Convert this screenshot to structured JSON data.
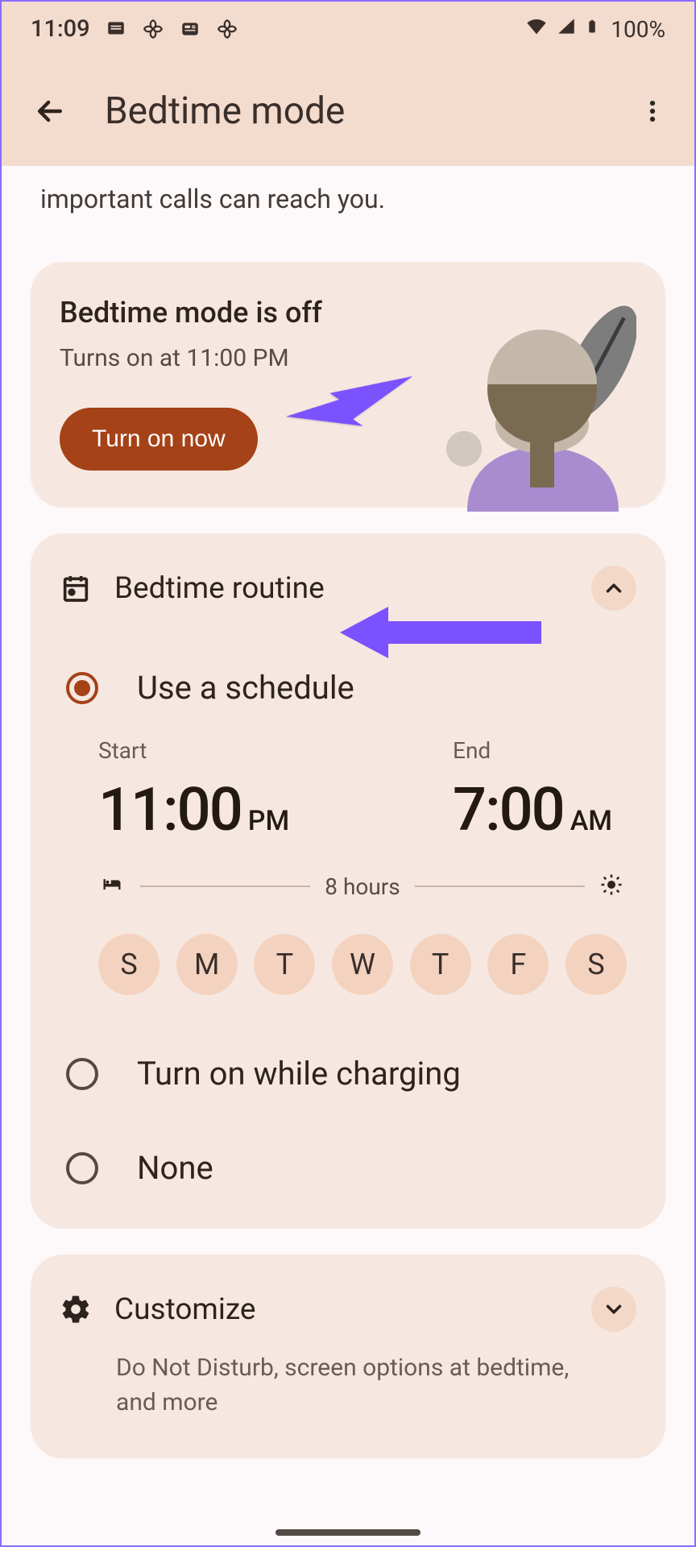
{
  "status_bar": {
    "time": "11:09",
    "battery_text": "100%"
  },
  "app_bar": {
    "title": "Bedtime mode"
  },
  "intro_text": "important calls can reach you.",
  "off_card": {
    "title": "Bedtime mode is off",
    "subtitle": "Turns on at 11:00 PM",
    "button_label": "Turn on now"
  },
  "routine": {
    "title": "Bedtime routine",
    "option_schedule": "Use a schedule",
    "option_charging": "Turn on while charging",
    "option_none": "None",
    "start_label": "Start",
    "end_label": "End",
    "start_time": "11:00",
    "start_ampm": "PM",
    "end_time": "7:00",
    "end_ampm": "AM",
    "duration": "8 hours",
    "days": [
      "S",
      "M",
      "T",
      "W",
      "T",
      "F",
      "S"
    ]
  },
  "customize": {
    "title": "Customize",
    "subtitle": "Do Not Disturb, screen options at bedtime, and more"
  },
  "colors": {
    "accent": "#a54217",
    "header_bg": "#f3dbce",
    "card_bg": "#f6e8e0",
    "chip_bg": "#f3d3c0",
    "arrow": "#7a52ff"
  }
}
